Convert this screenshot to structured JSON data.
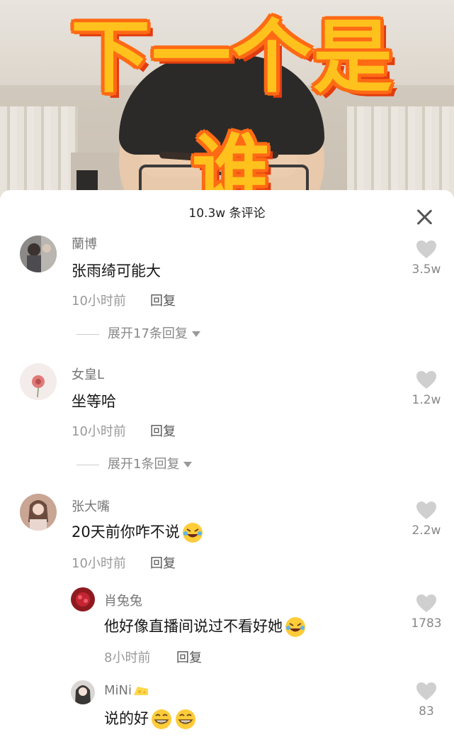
{
  "video": {
    "overlay_title": "下一个是谁"
  },
  "sheet": {
    "comment_count": "10.3w 条评论"
  },
  "comments": [
    {
      "user": "蘭博",
      "text": "张雨绮可能大",
      "time": "10小时前",
      "reply": "回复",
      "likes": "3.5w",
      "expand": "展开17条回复"
    },
    {
      "user": "女皇L",
      "text": "坐等哈",
      "time": "10小时前",
      "reply": "回复",
      "likes": "1.2w",
      "expand": "展开1条回复"
    },
    {
      "user": "张大嘴",
      "text": "20天前你咋不说",
      "time": "10小时前",
      "reply": "回复",
      "likes": "2.2w"
    }
  ],
  "replies": [
    {
      "user": "肖兔兔",
      "text": "他好像直播间说过不看好她",
      "time": "8小时前",
      "reply": "回复",
      "likes": "1783"
    },
    {
      "user": "MiNi",
      "text": "说的好",
      "likes": "83"
    }
  ]
}
